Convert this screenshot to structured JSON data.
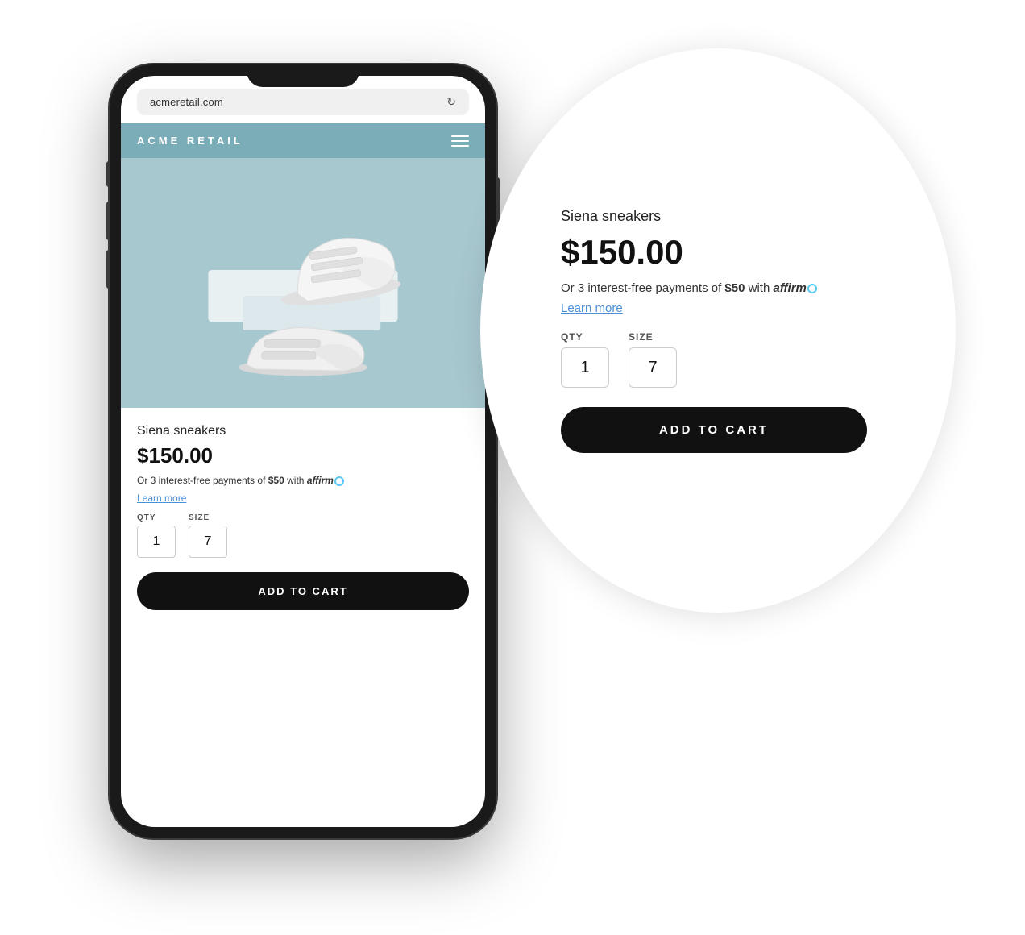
{
  "phone": {
    "address_bar": {
      "url": "acmeretail.com",
      "refresh_icon": "↻"
    },
    "nav": {
      "logo": "ACME RETAIL"
    },
    "product": {
      "name": "Siena sneakers",
      "price": "$150.00",
      "affirm_text": "Or 3 interest-free payments of",
      "affirm_amount": "$50",
      "affirm_with": "with",
      "affirm_brand": "affirm",
      "learn_more": "Learn more",
      "qty_label": "QTY",
      "qty_value": "1",
      "size_label": "SIZE",
      "size_value": "7",
      "add_to_cart": "ADD TO CART"
    }
  },
  "zoom": {
    "product": {
      "name": "Siena sneakers",
      "price": "$150.00",
      "affirm_text": "Or 3 interest-free payments of",
      "affirm_amount": "$50",
      "affirm_with": "with",
      "affirm_brand": "affirm",
      "learn_more": "Learn more",
      "qty_label": "QTY",
      "qty_value": "1",
      "size_label": "SIZE",
      "size_value": "7",
      "add_to_cart": "ADD TO CART"
    }
  }
}
